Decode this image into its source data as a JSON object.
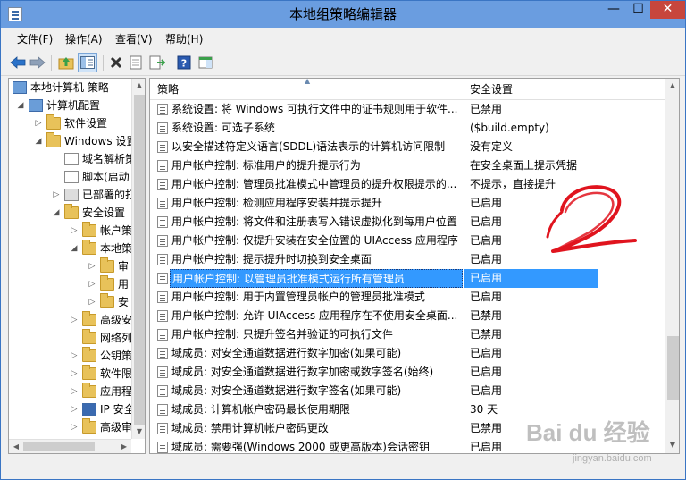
{
  "window": {
    "title": "本地组策略编辑器",
    "controls": {
      "minimize": "—",
      "maximize": "☐",
      "close": "✕"
    }
  },
  "menu": [
    {
      "label": "文件(F)"
    },
    {
      "label": "操作(A)"
    },
    {
      "label": "查看(V)"
    },
    {
      "label": "帮助(H)"
    }
  ],
  "toolbar": {
    "icons": [
      "back-arrow-icon",
      "forward-arrow-icon",
      "up-folder-icon",
      "show-tree-icon",
      "delete-icon",
      "properties-icon",
      "export-list-icon",
      "help-icon",
      "show-hide-pane-icon"
    ]
  },
  "tree": {
    "items": [
      {
        "label": "本地计算机 策略"
      },
      {
        "label": "计算机配置"
      },
      {
        "label": "软件设置"
      },
      {
        "label": "Windows 设置"
      },
      {
        "label": "域名解析策"
      },
      {
        "label": "脚本(启动"
      },
      {
        "label": "已部署的打"
      },
      {
        "label": "安全设置"
      },
      {
        "label": "帐户策"
      },
      {
        "label": "本地策"
      },
      {
        "label": "审"
      },
      {
        "label": "用"
      },
      {
        "label": "安"
      },
      {
        "label": "高级安"
      },
      {
        "label": "网络列"
      },
      {
        "label": "公钥策"
      },
      {
        "label": "软件限"
      },
      {
        "label": "应用程"
      },
      {
        "label": "IP 安全"
      },
      {
        "label": "高级审"
      }
    ]
  },
  "list": {
    "headers": {
      "policy": "策略",
      "setting": "安全设置"
    },
    "rows": [
      {
        "policy": "系统设置: 将 Windows 可执行文件中的证书规则用于软件...",
        "setting": "已禁用"
      },
      {
        "policy": "系统设置: 可选子系统",
        "setting": "($build.empty)"
      },
      {
        "policy": "以安全描述符定义语言(SDDL)语法表示的计算机访问限制",
        "setting": "没有定义"
      },
      {
        "policy": "用户帐户控制: 标准用户的提升提示行为",
        "setting": "在安全桌面上提示凭据"
      },
      {
        "policy": "用户帐户控制: 管理员批准模式中管理员的提升权限提示的...",
        "setting": "不提示，直接提升"
      },
      {
        "policy": "用户帐户控制: 检测应用程序安装并提示提升",
        "setting": "已启用"
      },
      {
        "policy": "用户帐户控制: 将文件和注册表写入错误虚拟化到每用户位置",
        "setting": "已启用"
      },
      {
        "policy": "用户帐户控制: 仅提升安装在安全位置的 UIAccess 应用程序",
        "setting": "已启用"
      },
      {
        "policy": "用户帐户控制: 提示提升时切换到安全桌面",
        "setting": "已启用"
      },
      {
        "policy": "用户帐户控制: 以管理员批准模式运行所有管理员",
        "setting": "已启用",
        "selected": true
      },
      {
        "policy": "用户帐户控制: 用于内置管理员帐户的管理员批准模式",
        "setting": "已启用"
      },
      {
        "policy": "用户帐户控制: 允许 UIAccess 应用程序在不使用安全桌面...",
        "setting": "已禁用"
      },
      {
        "policy": "用户帐户控制: 只提升签名并验证的可执行文件",
        "setting": "已禁用"
      },
      {
        "policy": "域成员: 对安全通道数据进行数字加密(如果可能)",
        "setting": "已启用"
      },
      {
        "policy": "域成员: 对安全通道数据进行数字加密或数字签名(始终)",
        "setting": "已启用"
      },
      {
        "policy": "域成员: 对安全通道数据进行数字签名(如果可能)",
        "setting": "已启用"
      },
      {
        "policy": "域成员: 计算机帐户密码最长使用期限",
        "setting": "30 天"
      },
      {
        "policy": "域成员: 禁用计算机帐户密码更改",
        "setting": "已禁用"
      },
      {
        "policy": "域成员: 需要强(Windows 2000 或更高版本)会话密钥",
        "setting": "已启用"
      }
    ]
  },
  "watermark": {
    "brand": "Bai du 经验",
    "url": "jingyan.baidu.com"
  },
  "colors": {
    "selection": "#3399ff",
    "titlebar": "#6a9de0",
    "annotation": "#e0141e"
  }
}
